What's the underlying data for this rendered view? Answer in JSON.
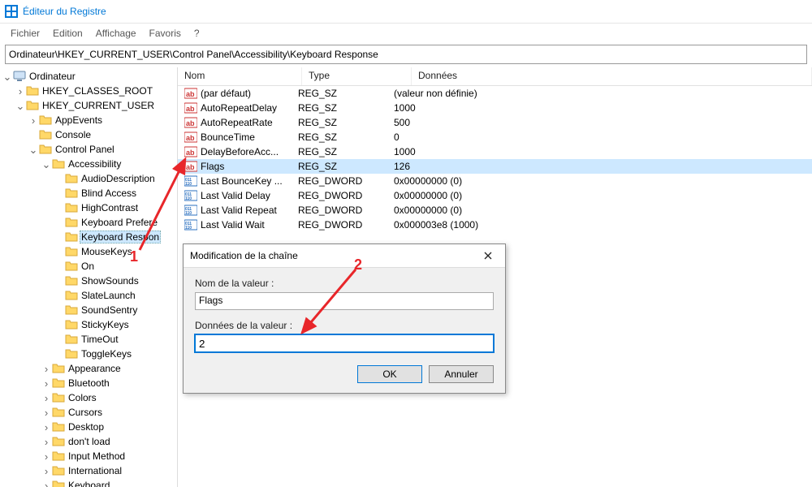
{
  "window": {
    "title": "Éditeur du Registre"
  },
  "menu": {
    "file": "Fichier",
    "edit": "Edition",
    "view": "Affichage",
    "fav": "Favoris",
    "help": "?"
  },
  "address": "Ordinateur\\HKEY_CURRENT_USER\\Control Panel\\Accessibility\\Keyboard Response",
  "tree": {
    "root": "Ordinateur",
    "hkcr": "HKEY_CLASSES_ROOT",
    "hkcu": "HKEY_CURRENT_USER",
    "children": {
      "appevents": "AppEvents",
      "console": "Console",
      "controlpanel": "Control Panel",
      "accessibility": "Accessibility",
      "acc_children": [
        "AudioDescription",
        "Blind Access",
        "HighContrast",
        "Keyboard Prefere",
        "Keyboard Respon",
        "MouseKeys",
        "On",
        "ShowSounds",
        "SlateLaunch",
        "SoundSentry",
        "StickyKeys",
        "TimeOut",
        "ToggleKeys"
      ],
      "tail": [
        "Appearance",
        "Bluetooth",
        "Colors",
        "Cursors",
        "Desktop",
        "don't load",
        "Input Method",
        "International",
        "Keyboard"
      ]
    }
  },
  "columns": {
    "name": "Nom",
    "type": "Type",
    "data": "Données"
  },
  "values": [
    {
      "icon": "sz",
      "name": "(par défaut)",
      "type": "REG_SZ",
      "data": "(valeur non définie)"
    },
    {
      "icon": "sz",
      "name": "AutoRepeatDelay",
      "type": "REG_SZ",
      "data": "1000"
    },
    {
      "icon": "sz",
      "name": "AutoRepeatRate",
      "type": "REG_SZ",
      "data": "500"
    },
    {
      "icon": "sz",
      "name": "BounceTime",
      "type": "REG_SZ",
      "data": "0"
    },
    {
      "icon": "sz",
      "name": "DelayBeforeAcc...",
      "type": "REG_SZ",
      "data": "1000"
    },
    {
      "icon": "sz",
      "name": "Flags",
      "type": "REG_SZ",
      "data": "126",
      "selected": true
    },
    {
      "icon": "dw",
      "name": "Last BounceKey ...",
      "type": "REG_DWORD",
      "data": "0x00000000 (0)"
    },
    {
      "icon": "dw",
      "name": "Last Valid Delay",
      "type": "REG_DWORD",
      "data": "0x00000000 (0)"
    },
    {
      "icon": "dw",
      "name": "Last Valid Repeat",
      "type": "REG_DWORD",
      "data": "0x00000000 (0)"
    },
    {
      "icon": "dw",
      "name": "Last Valid Wait",
      "type": "REG_DWORD",
      "data": "0x000003e8 (1000)"
    }
  ],
  "dialog": {
    "title": "Modification de la chaîne",
    "name_label": "Nom de la valeur :",
    "name_value": "Flags",
    "data_label": "Données de la valeur :",
    "data_value": "2",
    "ok": "OK",
    "cancel": "Annuler"
  },
  "annotations": {
    "a1": "1",
    "a2": "2"
  }
}
